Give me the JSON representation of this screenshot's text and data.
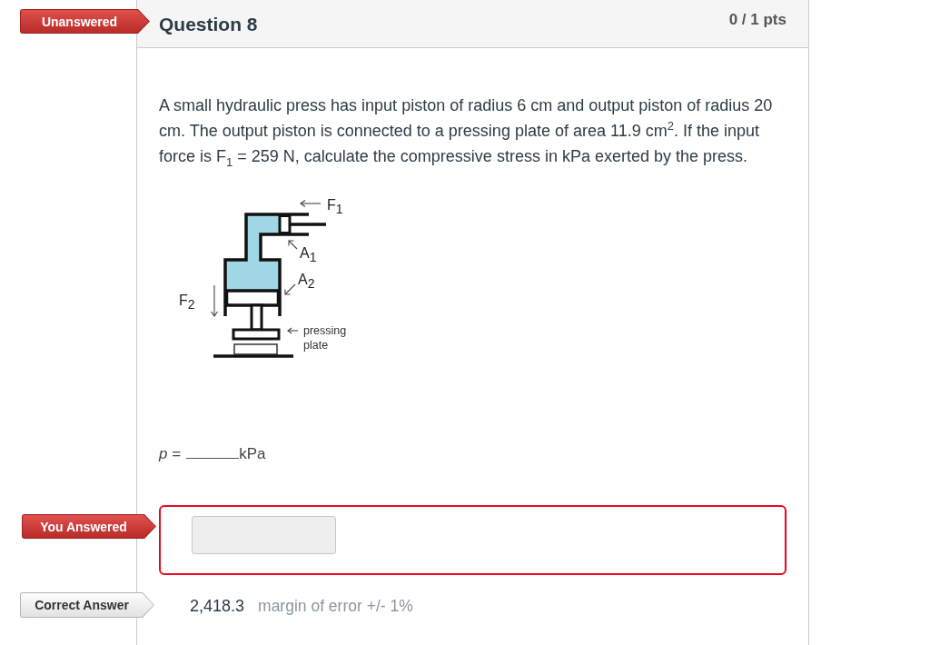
{
  "question": {
    "status_tag": {
      "text": "Unanswered",
      "kind": "alert"
    },
    "title": "Question 8",
    "points": "0 / 1 pts",
    "text": "A small hydraulic press has input piston of radius 6 cm and output piston of radius 20 cm. The output piston is connected to a pressing plate of area 11.9 cm$^{2}$. If the input force is F$_{1}$ = 259 N, calculate the compressive stress in kPa exerted by the press.",
    "figure": {
      "labels": [
        "F$_{1}$",
        "A$_{1}$",
        "A$_{2}$",
        "F$_{2}$",
        "pressing plate"
      ]
    },
    "prompt": {
      "before": "*p* =",
      "unit": "kPa"
    }
  },
  "answers": [
    {
      "kind": "given",
      "tag": {
        "text": "You Answered",
        "kind": "alert"
      },
      "correct": false,
      "disabled": true
    },
    {
      "kind": "key",
      "tag": {
        "text": "Correct Answer",
        "kind": "plain"
      },
      "value": "2,418.3",
      "margin": "margin of error +/- 1%"
    }
  ]
}
